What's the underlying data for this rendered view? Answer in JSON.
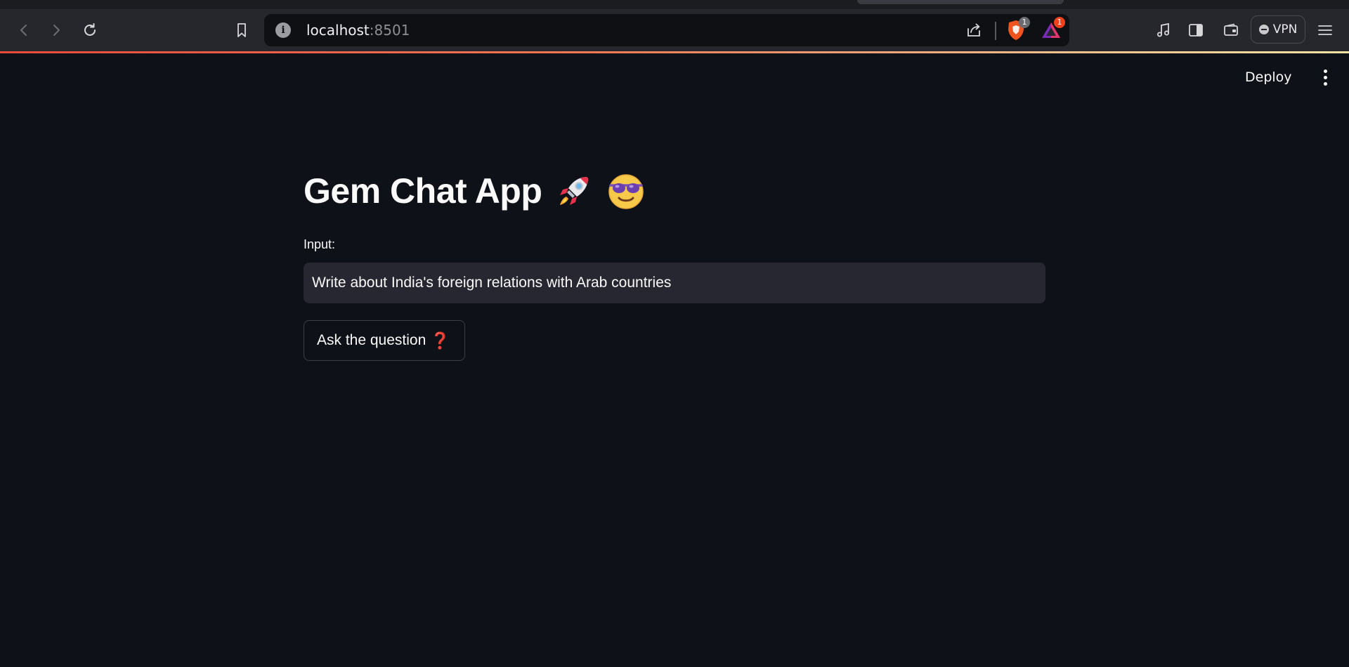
{
  "browser": {
    "url_host": "localhost",
    "url_port": ":8501",
    "shield_badge": "1",
    "rewards_badge": "1",
    "vpn_label": "VPN"
  },
  "app": {
    "deploy_label": "Deploy",
    "title": "Gem Chat App",
    "title_emojis": [
      "rocket-icon",
      "sunglasses-smiley-icon"
    ],
    "input_label": "Input:",
    "input_value": "Write about India's foreign relations with Arab countries",
    "ask_button_label": "Ask the question",
    "ask_button_emoji": "❓"
  },
  "colors": {
    "background": "#0e1117",
    "input_background": "#262730",
    "accent_gradient_start": "#e94b3c",
    "accent_gradient_end": "#f7e4a6"
  }
}
